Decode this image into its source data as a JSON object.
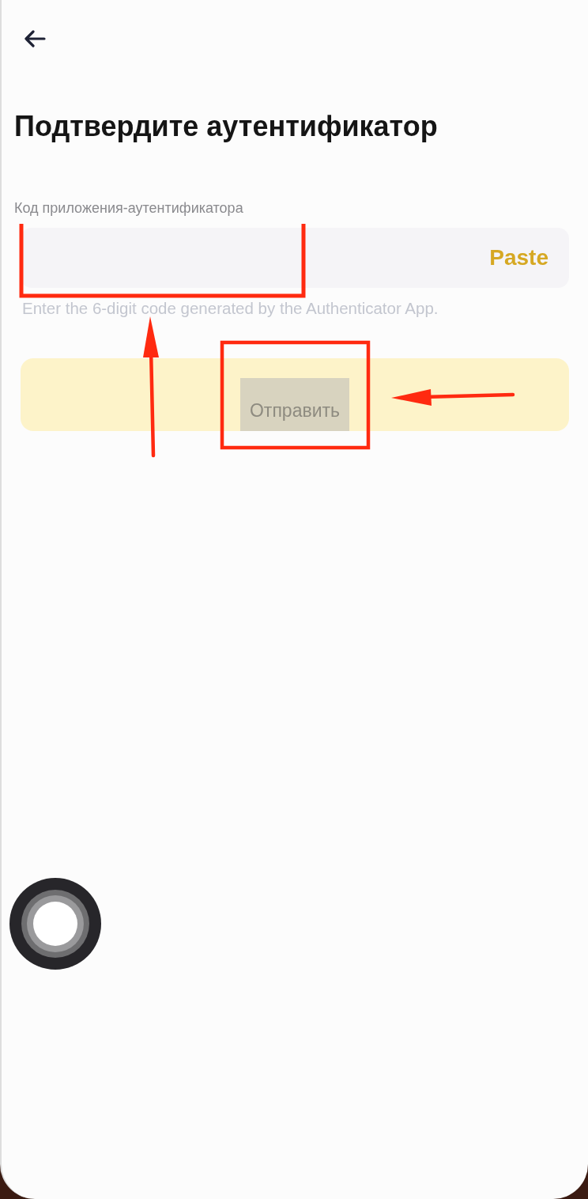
{
  "title": "Подтвердите аутентификатор",
  "code_field": {
    "label": "Код приложения-аутентификатора",
    "paste_button": "Paste",
    "hint": "Enter the 6-digit code generated by the Authenticator App."
  },
  "submit_button": {
    "label": "Отправить",
    "disabled": true
  }
}
